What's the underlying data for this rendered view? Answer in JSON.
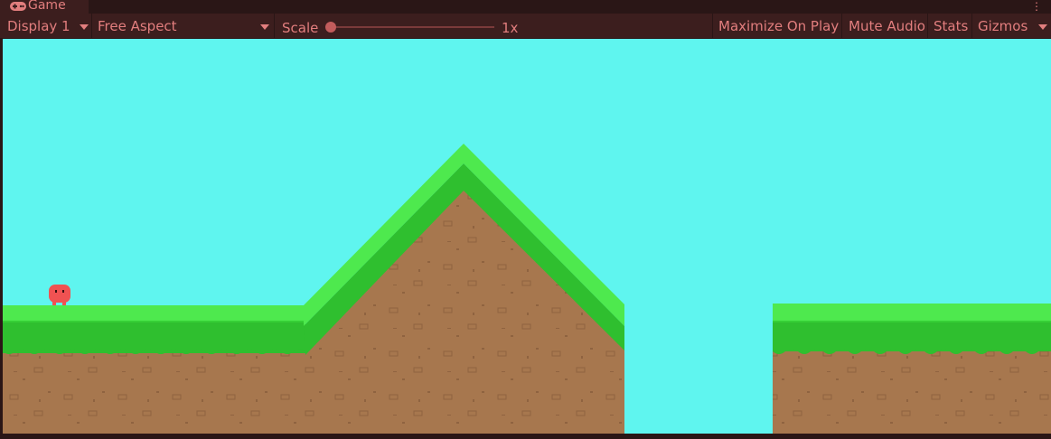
{
  "tab": {
    "label": "Game",
    "icon": "gamepad-icon"
  },
  "toolbar": {
    "display": "Display 1",
    "aspect": "Free Aspect",
    "scale_label": "Scale",
    "scale_value": "1x",
    "maximize": "Maximize On Play",
    "mute": "Mute Audio",
    "stats": "Stats",
    "gizmos": "Gizmos"
  },
  "colors": {
    "sky": "#5ff5ef",
    "grass_light": "#4ee94e",
    "grass_dark": "#2fbf2f",
    "dirt": "#a7774e",
    "player": "#f05252",
    "ui_text": "#e27e7e",
    "ui_bg": "#3c1e1e"
  }
}
